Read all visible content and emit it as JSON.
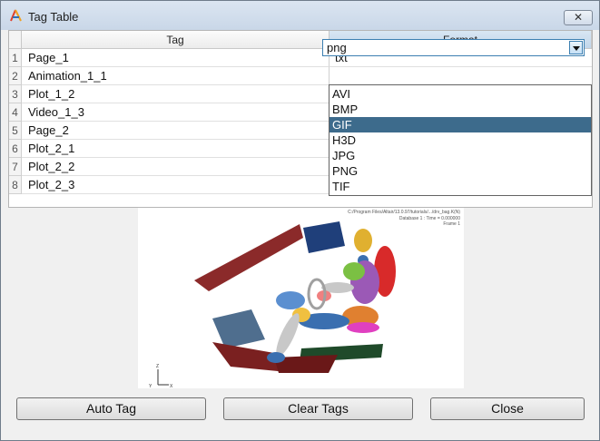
{
  "window": {
    "title": "Tag Table",
    "close_glyph": "✕"
  },
  "table": {
    "headers": {
      "tag": "Tag",
      "format": "Format"
    },
    "rows": [
      {
        "num": "1",
        "tag": "Page_1",
        "format": "txt"
      },
      {
        "num": "2",
        "tag": "Animation_1_1",
        "format": "png"
      },
      {
        "num": "3",
        "tag": "Plot_1_2",
        "format": ""
      },
      {
        "num": "4",
        "tag": "Video_1_3",
        "format": ""
      },
      {
        "num": "5",
        "tag": "Page_2",
        "format": ""
      },
      {
        "num": "6",
        "tag": "Plot_2_1",
        "format": ""
      },
      {
        "num": "7",
        "tag": "Plot_2_2",
        "format": ""
      },
      {
        "num": "8",
        "tag": "Plot_2_3",
        "format": ""
      }
    ]
  },
  "format_dropdown": {
    "current_value": "png",
    "options": [
      "AVI",
      "BMP",
      "GIF",
      "H3D",
      "JPG",
      "PNG",
      "TIF"
    ],
    "highlighted": "GIF"
  },
  "preview": {
    "path_text": "C:/Program Files/Altair/13.0.97/tutorials/.../drv_bag.K(N)",
    "info_line1": "Database 1 : Time = 0.000000",
    "info_line2": "Frame 1",
    "axis_z": "Z",
    "axis_y": "Y",
    "axis_x": "X"
  },
  "buttons": {
    "auto_tag": "Auto Tag",
    "clear_tags": "Clear Tags",
    "close": "Close"
  },
  "colors": {
    "titlebar": "#d2deec",
    "selected_option": "#3d6b8c",
    "format_header": "#c9dbec"
  }
}
